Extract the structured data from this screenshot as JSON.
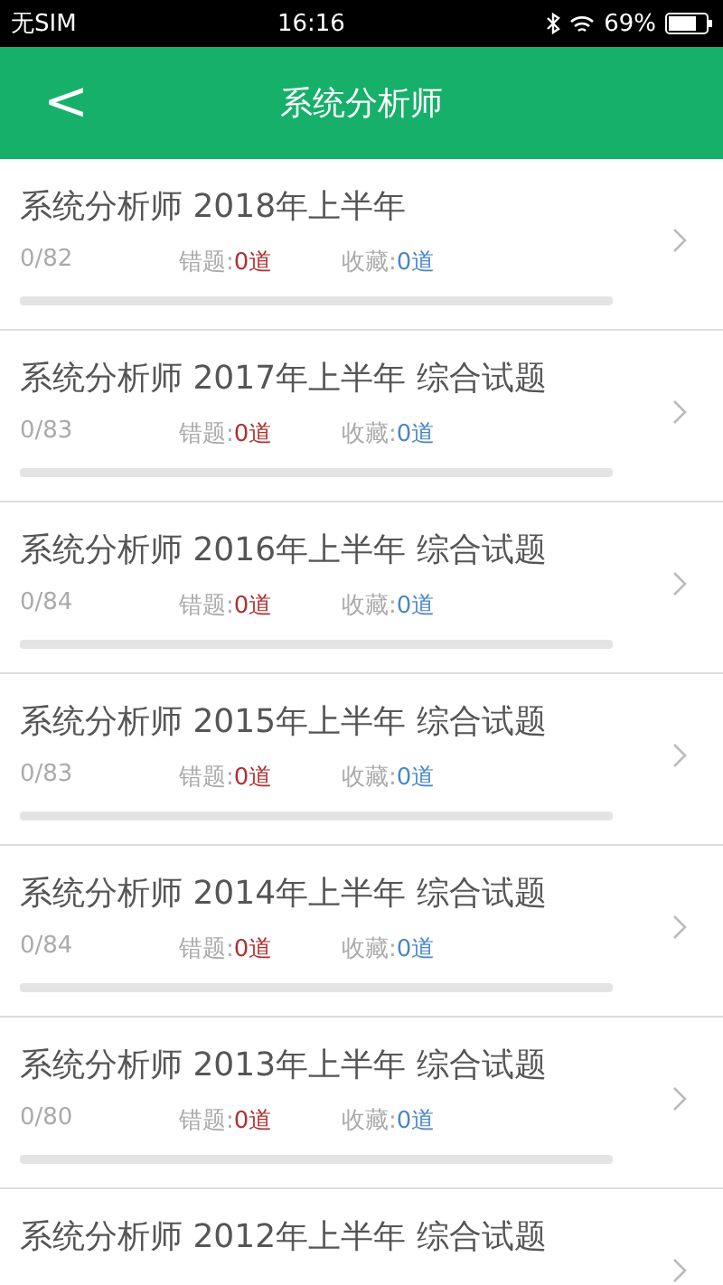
{
  "status_bar": {
    "carrier": "无SIM",
    "time": "16:16",
    "battery": "69%"
  },
  "header": {
    "back": "<",
    "title": "系统分析师"
  },
  "papers": [
    {
      "title": "系统分析师 2018年上半年",
      "progress": "0/82",
      "wrong_label": "错题:",
      "wrong_count": "0道",
      "fav_label": "收藏:",
      "fav_count": "0道",
      "level": 0
    },
    {
      "title": "系统分析师 2017年上半年 综合试题",
      "progress": "0/83",
      "wrong_label": "错题:",
      "wrong_count": "0道",
      "fav_label": "收藏:",
      "fav_count": "0道",
      "level": 0
    },
    {
      "title": "系统分析师 2016年上半年 综合试题",
      "progress": "0/84",
      "wrong_label": "错题:",
      "wrong_count": "0道",
      "fav_label": "收藏:",
      "fav_count": "0道",
      "level": 0
    },
    {
      "title": "系统分析师 2015年上半年 综合试题",
      "progress": "0/83",
      "wrong_label": "错题:",
      "wrong_count": "0道",
      "fav_label": "收藏:",
      "fav_count": "0道",
      "level": 0
    },
    {
      "title": "系统分析师 2014年上半年 综合试题",
      "progress": "0/84",
      "wrong_label": "错题:",
      "wrong_count": "0道",
      "fav_label": "收藏:",
      "fav_count": "0道",
      "level": 0
    },
    {
      "title": "系统分析师 2013年上半年 综合试题",
      "progress": "0/80",
      "wrong_label": "错题:",
      "wrong_count": "0道",
      "fav_label": "收藏:",
      "fav_count": "0道",
      "level": 0
    },
    {
      "title": "系统分析师 2012年上半年 综合试题"
    }
  ]
}
